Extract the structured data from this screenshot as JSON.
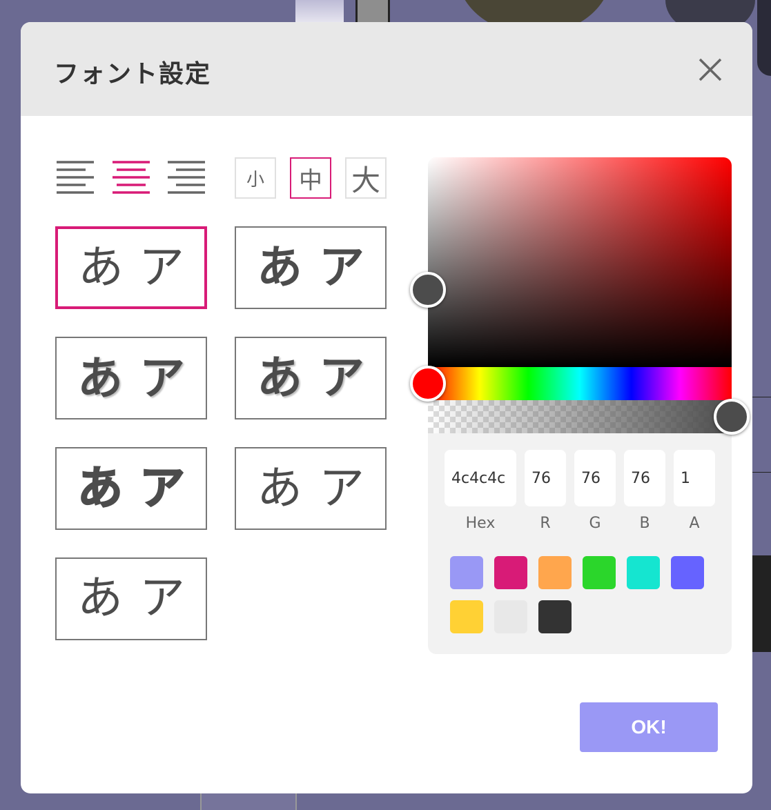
{
  "dialog": {
    "title": "フォント設定"
  },
  "alignment": {
    "options": [
      "left",
      "center",
      "right"
    ],
    "selected": "center"
  },
  "size": {
    "options": [
      "小",
      "中",
      "大"
    ],
    "selected": "中"
  },
  "font_styles": [
    {
      "hira": "あ",
      "kata": "ア",
      "selected": true
    },
    {
      "hira": "あ",
      "kata": "ア",
      "selected": false
    },
    {
      "hira": "あ",
      "kata": "ア",
      "selected": false
    },
    {
      "hira": "あ",
      "kata": "ア",
      "selected": false
    },
    {
      "hira": "あ",
      "kata": "ア",
      "selected": false
    },
    {
      "hira": "あ",
      "kata": "ア",
      "selected": false
    },
    {
      "hira": "あ",
      "kata": "ア",
      "selected": false
    }
  ],
  "color": {
    "hex": "4c4c4c",
    "r": "76",
    "g": "76",
    "b": "76",
    "a": "1",
    "labels": {
      "hex": "Hex",
      "r": "R",
      "g": "G",
      "b": "B",
      "a": "A"
    },
    "hue_color": "#ff0000",
    "current_color": "#4c4c4c"
  },
  "swatches": [
    "#9998f5",
    "#d81b77",
    "#ffa64d",
    "#2bd62b",
    "#15e5d0",
    "#6663ff",
    "#ffd134",
    "#e8e8e8",
    "#333333"
  ],
  "accent_color": "#d81b77",
  "ok_label": "OK!"
}
